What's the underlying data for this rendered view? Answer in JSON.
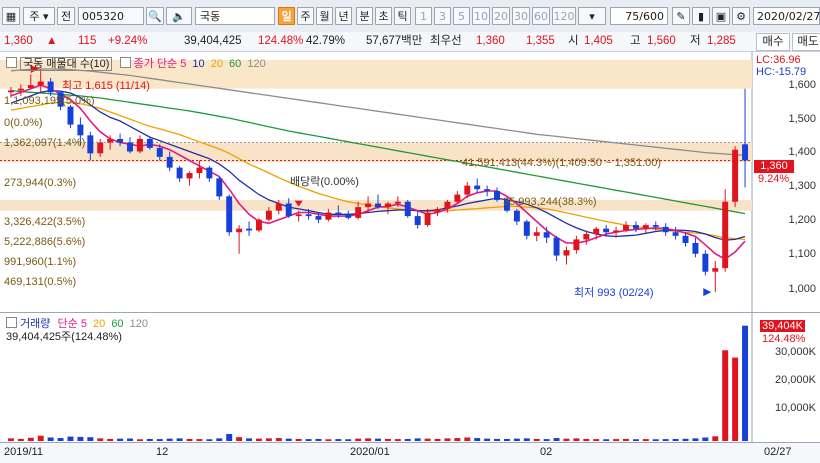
{
  "toolbar": {
    "type_label": "주",
    "period_label": "전",
    "code": "005320",
    "name": "국동",
    "intervals": [
      "일",
      "주",
      "월",
      "년",
      "분",
      "초",
      "틱"
    ],
    "selected_interval": "일",
    "numbers": [
      "1",
      "3",
      "5",
      "10",
      "20",
      "30",
      "60",
      "120"
    ],
    "count": "75",
    "count_total": "/600",
    "date": "2020/02/27",
    "icons": [
      "search-icon",
      "speaker-icon",
      "tools-icon",
      "bar-chart-icon",
      "save-icon",
      "print-icon",
      "settings-icon"
    ]
  },
  "quote": {
    "price": "1,360",
    "arrow": "▲",
    "change": "115",
    "change_pct": "+9.24%",
    "volume": "39,404,425",
    "volume_ratio": "124.48%",
    "turnover": "42.79%",
    "amount": "57,677백만",
    "best_priority": "최우선",
    "ask": "1,360",
    "bid": "1,355",
    "open_label": "시",
    "open": "1,405",
    "high_label": "고",
    "high": "1,560",
    "low_label": "저",
    "low": "1,285",
    "buy_button": "매수",
    "sell_button": "매도"
  },
  "price_panel": {
    "legend_title": "국동 매물대 수(10)",
    "ma_label": "종가 단순",
    "ma_periods": [
      "5",
      "10",
      "20",
      "60",
      "120"
    ],
    "ma_colors": [
      "#e0198a",
      "#1e2fa8",
      "#f0a000",
      "#1f9a3a",
      "#8c8c8c"
    ],
    "lc_label": "LC:36.96",
    "hc_label": "HC:-15.79",
    "high_annotation": "최고 1,615 (11/14)",
    "low_annotation": "최저 993 (02/24)",
    "dividend_annotation": "배당락(0.00%)",
    "current_price": "1,360",
    "current_pct": "9.24%",
    "y_ticks": [
      "1,600",
      "1,500",
      "1,400",
      "1,300",
      "1,200",
      "1,100",
      "1,000"
    ],
    "volume_profile_labels": [
      "1,1,093,195(5.0%)",
      "0(0.0%)",
      "1,362,097(1.4%)",
      "41,591,413(44.3%)(1,409.50 ~ 1,351.00)",
      "273,944(0.3%)",
      "35,993,244(38.3%)",
      "3,326,422(3.5%)",
      "5,222,886(5.6%)",
      "991,960(1.1%)",
      "469,131(0.5%)"
    ]
  },
  "volume_panel": {
    "legend_title": "거래량",
    "ma_label": "단순",
    "ma_periods": [
      "5",
      "20",
      "60",
      "120"
    ],
    "ma_colors": [
      "#e0198a",
      "#f0a000",
      "#1f9a3a",
      "#8c8c8c"
    ],
    "current_volume": "39,404,425주(124.48%)",
    "last_volume_badge": "39,404K",
    "last_volume_pct": "124.48%",
    "y_ticks": [
      "30,000K",
      "20,000K",
      "10,000K"
    ]
  },
  "x_axis": {
    "labels": [
      "2019/11",
      "12",
      "2020/01",
      "02"
    ],
    "last_date": "02/27"
  },
  "chart_data": {
    "type": "candlestick",
    "candles": [
      [
        1550,
        1565,
        1535,
        1555
      ],
      [
        1555,
        1572,
        1540,
        1560
      ],
      [
        1562,
        1600,
        1560,
        1570
      ],
      [
        1570,
        1615,
        1550,
        1580
      ],
      [
        1580,
        1590,
        1540,
        1550
      ],
      [
        1550,
        1555,
        1500,
        1510
      ],
      [
        1510,
        1515,
        1450,
        1460
      ],
      [
        1460,
        1480,
        1400,
        1430
      ],
      [
        1430,
        1440,
        1360,
        1380
      ],
      [
        1380,
        1420,
        1370,
        1410
      ],
      [
        1410,
        1430,
        1390,
        1420
      ],
      [
        1420,
        1435,
        1400,
        1410
      ],
      [
        1410,
        1425,
        1380,
        1385
      ],
      [
        1385,
        1430,
        1380,
        1420
      ],
      [
        1420,
        1425,
        1390,
        1395
      ],
      [
        1395,
        1405,
        1360,
        1370
      ],
      [
        1370,
        1385,
        1330,
        1340
      ],
      [
        1340,
        1345,
        1300,
        1310
      ],
      [
        1310,
        1330,
        1290,
        1325
      ],
      [
        1325,
        1360,
        1310,
        1340
      ],
      [
        1340,
        1345,
        1300,
        1310
      ],
      [
        1310,
        1315,
        1250,
        1260
      ],
      [
        1260,
        1265,
        1150,
        1160
      ],
      [
        1160,
        1180,
        1100,
        1170
      ],
      [
        1170,
        1190,
        1150,
        1165
      ],
      [
        1165,
        1200,
        1160,
        1195
      ],
      [
        1195,
        1230,
        1190,
        1220
      ],
      [
        1220,
        1250,
        1210,
        1240
      ],
      [
        1240,
        1255,
        1200,
        1205
      ],
      [
        1205,
        1220,
        1190,
        1210
      ],
      [
        1210,
        1225,
        1195,
        1205
      ],
      [
        1205,
        1215,
        1185,
        1195
      ],
      [
        1195,
        1225,
        1190,
        1215
      ],
      [
        1215,
        1235,
        1200,
        1210
      ],
      [
        1210,
        1220,
        1195,
        1200
      ],
      [
        1200,
        1245,
        1195,
        1230
      ],
      [
        1230,
        1260,
        1215,
        1240
      ],
      [
        1240,
        1265,
        1225,
        1230
      ],
      [
        1230,
        1245,
        1210,
        1240
      ],
      [
        1240,
        1260,
        1230,
        1245
      ],
      [
        1245,
        1250,
        1200,
        1205
      ],
      [
        1205,
        1220,
        1170,
        1180
      ],
      [
        1180,
        1225,
        1175,
        1215
      ],
      [
        1215,
        1230,
        1205,
        1225
      ],
      [
        1225,
        1250,
        1215,
        1245
      ],
      [
        1245,
        1275,
        1240,
        1265
      ],
      [
        1265,
        1300,
        1255,
        1290
      ],
      [
        1290,
        1310,
        1270,
        1280
      ],
      [
        1280,
        1290,
        1260,
        1275
      ],
      [
        1275,
        1285,
        1245,
        1250
      ],
      [
        1250,
        1255,
        1215,
        1220
      ],
      [
        1220,
        1225,
        1180,
        1190
      ],
      [
        1190,
        1195,
        1140,
        1150
      ],
      [
        1150,
        1175,
        1135,
        1160
      ],
      [
        1160,
        1175,
        1130,
        1145
      ],
      [
        1145,
        1150,
        1080,
        1095
      ],
      [
        1095,
        1120,
        1070,
        1110
      ],
      [
        1110,
        1150,
        1100,
        1140
      ],
      [
        1140,
        1165,
        1125,
        1155
      ],
      [
        1155,
        1175,
        1140,
        1170
      ],
      [
        1170,
        1180,
        1150,
        1160
      ],
      [
        1160,
        1175,
        1145,
        1165
      ],
      [
        1165,
        1190,
        1160,
        1180
      ],
      [
        1180,
        1190,
        1160,
        1170
      ],
      [
        1170,
        1185,
        1155,
        1180
      ],
      [
        1180,
        1190,
        1165,
        1175
      ],
      [
        1175,
        1185,
        1150,
        1160
      ],
      [
        1160,
        1175,
        1140,
        1150
      ],
      [
        1150,
        1160,
        1120,
        1130
      ],
      [
        1130,
        1145,
        1090,
        1100
      ],
      [
        1100,
        1110,
        1040,
        1050
      ],
      [
        1050,
        1080,
        993,
        1060
      ],
      [
        1060,
        1280,
        1050,
        1245
      ],
      [
        1245,
        1400,
        1230,
        1390
      ],
      [
        1405,
        1560,
        1285,
        1360
      ]
    ],
    "volumes": [
      900,
      700,
      1100,
      1800,
      1200,
      1000,
      1500,
      1400,
      1300,
      900,
      700,
      800,
      850,
      600,
      700,
      650,
      800,
      900,
      700,
      650,
      600,
      900,
      2400,
      1300,
      900,
      800,
      900,
      1000,
      800,
      700,
      650,
      700,
      600,
      650,
      600,
      800,
      900,
      800,
      700,
      650,
      700,
      900,
      800,
      700,
      900,
      1000,
      1200,
      1000,
      800,
      700,
      700,
      800,
      900,
      700,
      650,
      1000,
      800,
      900,
      700,
      650,
      600,
      650,
      700,
      600,
      650,
      600,
      650,
      700,
      750,
      900,
      1200,
      1600,
      31000,
      28500,
      39404
    ],
    "ma": {
      "5": [
        1540,
        1550,
        1560,
        1570,
        1560,
        1545,
        1530,
        1505,
        1470,
        1440,
        1420,
        1410,
        1405,
        1400,
        1405,
        1400,
        1390,
        1375,
        1360,
        1345,
        1330,
        1315,
        1280,
        1240,
        1210,
        1190,
        1185,
        1195,
        1205,
        1215,
        1215,
        1210,
        1205,
        1205,
        1205,
        1210,
        1220,
        1230,
        1232,
        1238,
        1230,
        1220,
        1210,
        1215,
        1225,
        1240,
        1260,
        1270,
        1275,
        1275,
        1260,
        1240,
        1215,
        1190,
        1165,
        1145,
        1130,
        1130,
        1135,
        1145,
        1155,
        1160,
        1165,
        1168,
        1170,
        1172,
        1170,
        1165,
        1158,
        1148,
        1125,
        1100,
        1085,
        1105,
        1135
      ],
      "10": [
        1520,
        1530,
        1540,
        1550,
        1555,
        1553,
        1548,
        1535,
        1515,
        1495,
        1480,
        1470,
        1455,
        1440,
        1425,
        1415,
        1405,
        1395,
        1385,
        1375,
        1365,
        1350,
        1330,
        1305,
        1285,
        1265,
        1250,
        1240,
        1230,
        1225,
        1220,
        1215,
        1210,
        1210,
        1210,
        1212,
        1215,
        1218,
        1220,
        1222,
        1222,
        1220,
        1220,
        1222,
        1228,
        1233,
        1240,
        1245,
        1250,
        1255,
        1250,
        1245,
        1238,
        1228,
        1215,
        1200,
        1185,
        1172,
        1162,
        1155,
        1150,
        1148,
        1150,
        1152,
        1157,
        1162,
        1165,
        1166,
        1165,
        1162,
        1155,
        1145,
        1138,
        1140,
        1148
      ],
      "20": [
        1500,
        1505,
        1510,
        1515,
        1520,
        1522,
        1522,
        1518,
        1512,
        1505,
        1495,
        1485,
        1475,
        1465,
        1455,
        1448,
        1440,
        1432,
        1422,
        1412,
        1402,
        1392,
        1380,
        1365,
        1350,
        1338,
        1325,
        1312,
        1300,
        1288,
        1278,
        1268,
        1260,
        1252,
        1245,
        1240,
        1236,
        1232,
        1228,
        1225,
        1222,
        1220,
        1218,
        1218,
        1220,
        1222,
        1224,
        1226,
        1228,
        1230,
        1232,
        1232,
        1230,
        1228,
        1225,
        1220,
        1214,
        1208,
        1202,
        1196,
        1190,
        1185,
        1180,
        1176,
        1172,
        1168,
        1165,
        1162,
        1160,
        1158,
        1155,
        1150,
        1145,
        1142,
        1140
      ],
      "60": [
        1555,
        1552,
        1550,
        1548,
        1546,
        1544,
        1542,
        1540,
        1537,
        1534,
        1530,
        1526,
        1522,
        1518,
        1514,
        1510,
        1506,
        1502,
        1498,
        1493,
        1488,
        1483,
        1478,
        1472,
        1466,
        1460,
        1454,
        1448,
        1442,
        1437,
        1432,
        1427,
        1422,
        1417,
        1412,
        1407,
        1402,
        1397,
        1392,
        1387,
        1382,
        1377,
        1372,
        1367,
        1362,
        1357,
        1352,
        1347,
        1342,
        1337,
        1332,
        1327,
        1322,
        1317,
        1312,
        1307,
        1302,
        1297,
        1292,
        1287,
        1282,
        1277,
        1272,
        1267,
        1262,
        1257,
        1252,
        1247,
        1242,
        1237,
        1232,
        1227,
        1222,
        1217,
        1212
      ],
      "120": [
        1610,
        1612,
        1614,
        1615,
        1615,
        1614,
        1613,
        1611,
        1609,
        1606,
        1603,
        1600,
        1597,
        1593,
        1589,
        1585,
        1581,
        1577,
        1573,
        1569,
        1565,
        1561,
        1557,
        1553,
        1549,
        1545,
        1541,
        1537,
        1533,
        1529,
        1525,
        1521,
        1517,
        1513,
        1509,
        1505,
        1501,
        1497,
        1493,
        1489,
        1485,
        1481,
        1477,
        1473,
        1469,
        1465,
        1461,
        1457,
        1453,
        1449,
        1445,
        1441,
        1437,
        1433,
        1430,
        1427,
        1424,
        1421,
        1418,
        1415,
        1412,
        1409,
        1406,
        1403,
        1400,
        1397,
        1394,
        1391,
        1388,
        1385,
        1382,
        1380,
        1378,
        1376,
        1374
      ]
    },
    "ylim": [
      960,
      1640
    ],
    "volume_ylim": [
      0,
      41000
    ]
  }
}
